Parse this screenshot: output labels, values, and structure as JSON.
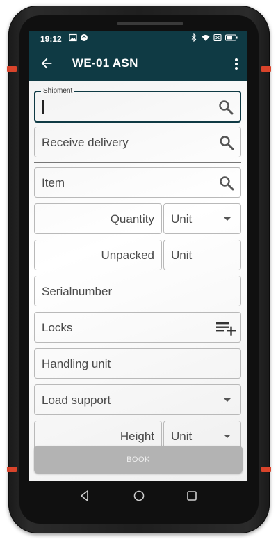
{
  "status": {
    "time": "19:12"
  },
  "appbar": {
    "title": "WE-01 ASN"
  },
  "form": {
    "shipment_label": "Shipment",
    "shipment_value": "",
    "receive_delivery": "Receive delivery",
    "item": "Item",
    "quantity": "Quantity",
    "quantity_unit": "Unit",
    "unpacked": "Unpacked",
    "unpacked_unit": "Unit",
    "serialnumber": "Serialnumber",
    "locks": "Locks",
    "handling_unit": "Handling unit",
    "load_support": "Load support",
    "height": "Height",
    "height_unit": "Unit"
  },
  "actions": {
    "book": "BOOK"
  },
  "colors": {
    "appbar": "#0f3a44",
    "side_accent": "#d9442b",
    "button_disabled": "#b3b3b3"
  },
  "icons": [
    "back-arrow-icon",
    "more-vert-icon",
    "search-icon",
    "playlist-add-icon",
    "chevron-down-icon",
    "nav-back-icon",
    "nav-home-icon",
    "nav-recents-icon",
    "bluetooth-icon",
    "wifi-icon",
    "battery-icon",
    "image-icon",
    "notification-icon",
    "no-sim-icon"
  ]
}
